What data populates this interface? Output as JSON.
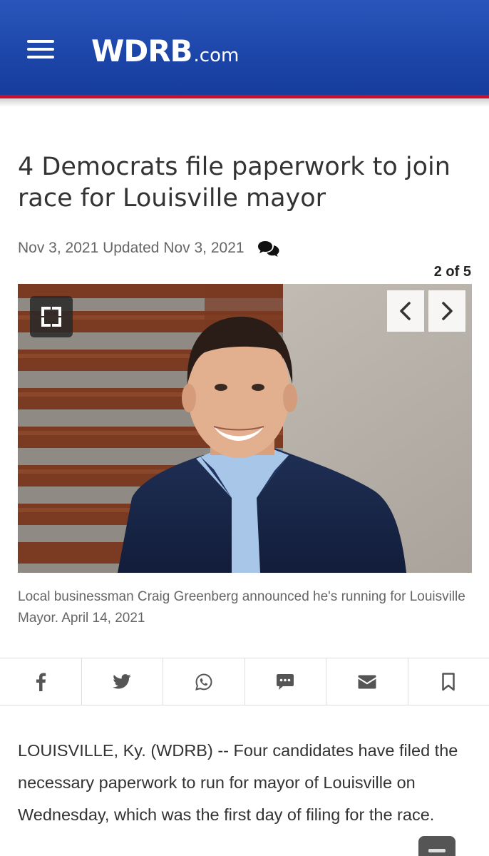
{
  "header": {
    "logo_main": "WDRB",
    "logo_sub": ".com",
    "brand_color": "#1c45a8",
    "accent_line_color": "#c8102e"
  },
  "article": {
    "headline": "4 Democrats file paperwork to join race for Louisville mayor",
    "meta": "Nov 3, 2021 Updated Nov 3, 2021",
    "gallery": {
      "counter": "2 of 5",
      "caption": "Local businessman Craig Greenberg announced he's running for Louisville Mayor. April 14, 2021"
    },
    "body": "LOUISVILLE, Ky. (WDRB) -- Four candidates have filed the necessary paperwork to run for mayor of Louisville on Wednesday, which was the first day of filing for the race."
  },
  "share_bar": {
    "items": [
      "facebook-icon",
      "twitter-icon",
      "whatsapp-icon",
      "sms-icon",
      "email-icon",
      "bookmark-icon"
    ]
  },
  "icons": {
    "menu": "hamburger-menu-icon",
    "comments": "comments-icon",
    "expand": "fullscreen-expand-icon",
    "prev": "chevron-left-icon",
    "next": "chevron-right-icon"
  }
}
